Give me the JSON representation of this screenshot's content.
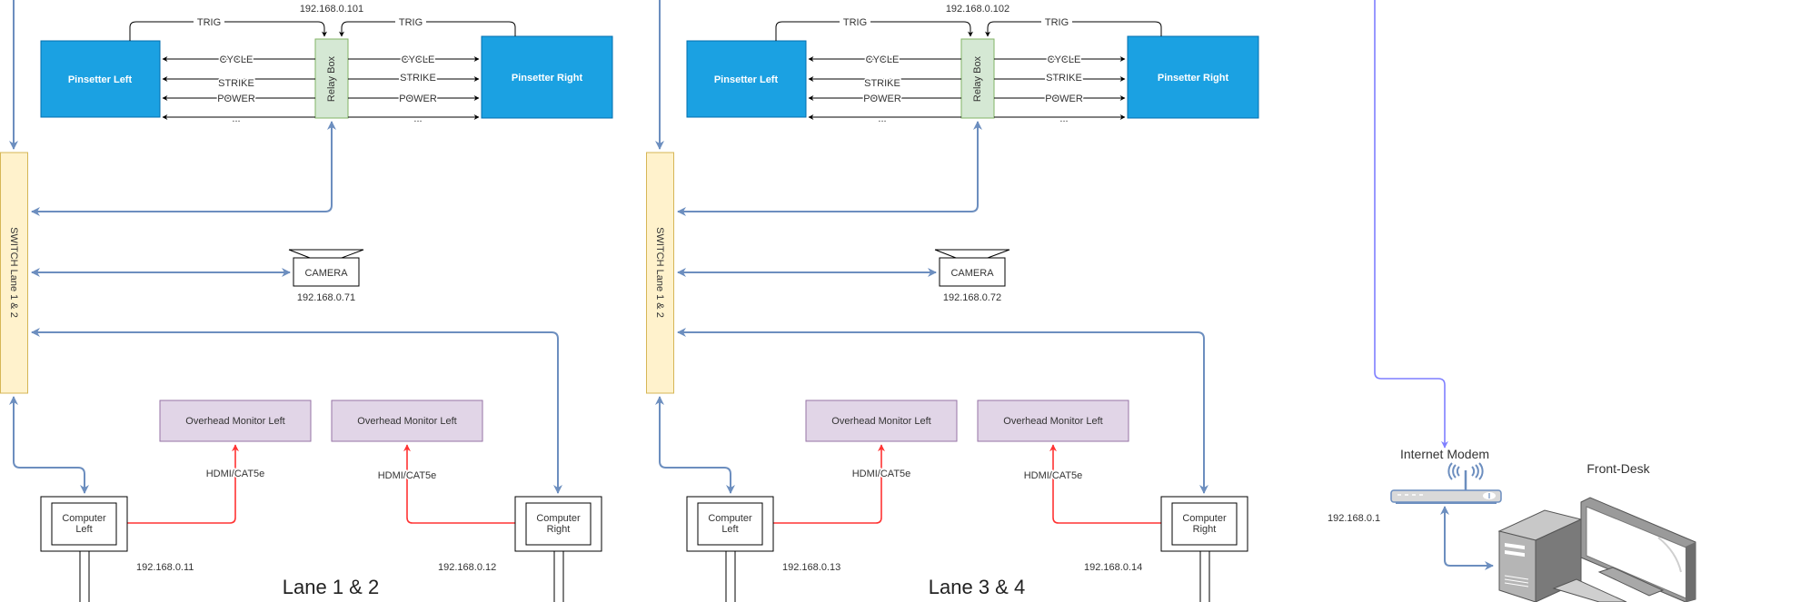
{
  "colors": {
    "pinsetter_fill": "#1ba1e2",
    "pinsetter_stroke": "#006eaf",
    "relay_fill": "#d5e8d4",
    "relay_stroke": "#82b366",
    "switch_fill": "#fff2cc",
    "switch_stroke": "#d6b656",
    "monitor_fill": "#e1d5e7",
    "monitor_stroke": "#9673a6",
    "network_link": "#6c8ebf",
    "hdmi_link": "#ff3333",
    "internet_link": "#7f7fff",
    "signal_line": "#000000"
  },
  "lanes": [
    {
      "title": "Lane 1 & 2",
      "relay_ip": "192.168.0.101",
      "relay_label": "Relay Box",
      "switch_label": "SWITCH Lane 1 & 2",
      "pinsetter_left": "Pinsetter Left",
      "pinsetter_right": "Pinsetter Right",
      "signals_left": [
        "CYCLE",
        "STRIKE",
        "POWER",
        "..."
      ],
      "signals_right": [
        "CYCLE",
        "STRIKE",
        "POWER",
        "..."
      ],
      "trig_label": "TRIG",
      "camera_label": "CAMERA",
      "camera_ip": "192.168.0.71",
      "monitor_left": "Overhead Monitor Left",
      "monitor_right": "Overhead Monitor Left",
      "hdmi_label": "HDMI/CAT5e",
      "computer_left": [
        "Computer",
        "Left"
      ],
      "computer_right": [
        "Computer",
        "Right"
      ],
      "computer_left_ip": "192.168.0.11",
      "computer_right_ip": "192.168.0.12"
    },
    {
      "title": "Lane 3 & 4",
      "relay_ip": "192.168.0.102",
      "relay_label": "Relay Box",
      "switch_label": "SWITCH Lane 1 & 2",
      "pinsetter_left": "Pinsetter Left",
      "pinsetter_right": "Pinsetter Right",
      "signals_left": [
        "CYCLE",
        "STRIKE",
        "POWER",
        "..."
      ],
      "signals_right": [
        "CYCLE",
        "STRIKE",
        "POWER",
        "..."
      ],
      "trig_label": "TRIG",
      "camera_label": "CAMERA",
      "camera_ip": "192.168.0.72",
      "monitor_left": "Overhead Monitor Left",
      "monitor_right": "Overhead Monitor Left",
      "hdmi_label": "HDMI/CAT5e",
      "computer_left": [
        "Computer",
        "Left"
      ],
      "computer_right": [
        "Computer",
        "Right"
      ],
      "computer_left_ip": "192.168.0.13",
      "computer_right_ip": "192.168.0.14"
    }
  ],
  "modem": {
    "label": "Internet Modem",
    "ip": "192.168.0.1",
    "icon": "wireless-router-icon"
  },
  "front_desk": {
    "label": "Front-Desk",
    "icon": "desktop-computer-icon"
  }
}
